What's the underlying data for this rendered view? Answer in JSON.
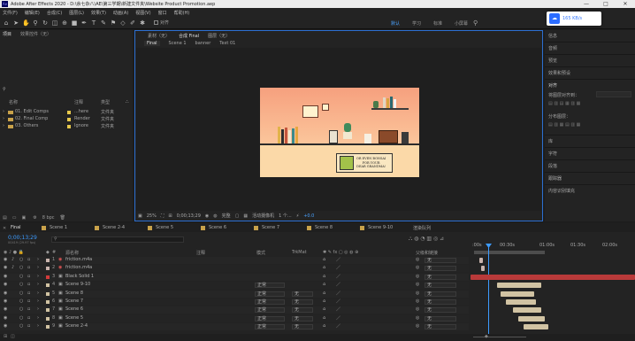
{
  "window": {
    "title": "Adobe After Effects 2020 - D:\\余七杂八\\AE\\第三学期\\新建文件夹\\Website Product Promotion.aep",
    "minimize": "—",
    "maximize": "□",
    "close": "✕"
  },
  "menu": [
    "文件(F)",
    "编辑(E)",
    "合成(C)",
    "图层(L)",
    "效果(T)",
    "动画(A)",
    "视图(V)",
    "窗口",
    "帮助(H)"
  ],
  "toolbar": {
    "snap_label": "对齐",
    "workspaces": [
      "默认",
      "学习",
      "标准",
      "小屏幕"
    ],
    "active_workspace": "默认"
  },
  "network_widget": {
    "speed": "165 KB/s"
  },
  "project_panel": {
    "tabs": [
      "项目",
      "效果控件（无）"
    ],
    "columns": [
      "名称",
      "注释",
      "类型"
    ],
    "items": [
      {
        "name": "01. Edit Comps",
        "comment": "...here",
        "type": "文件夹"
      },
      {
        "name": "02. Final Comp",
        "comment": "Render",
        "type": "文件夹"
      },
      {
        "name": "03. Others",
        "comment": "Ignore",
        "type": "文件夹"
      }
    ],
    "footer_bpc": "8 bpc"
  },
  "composition_panel": {
    "tabs": [
      "素材（无）",
      "合成 Final",
      "图层（无）"
    ],
    "breadcrumbs": [
      "Final",
      "Scene 1",
      "banner",
      "Text 01"
    ],
    "footer": {
      "zoom": "25%",
      "timecode": "0;00;13;29",
      "resolution": "完整",
      "camera": "活动摄像机",
      "views": "1 个...",
      "exposure": "+0.0"
    },
    "canvas_text": [
      "OR EVEN BONSAI",
      "FOR YOUR",
      "DEAR GRANDMA!"
    ]
  },
  "right_panels": [
    "信息",
    "音频",
    "预览",
    "效果和预设",
    "对齐",
    "将图层对齐到：",
    "分布图层：",
    "库",
    "字符",
    "段落",
    "跟踪器",
    "内容识别填充"
  ],
  "timeline": {
    "tabs": [
      "Final",
      "Scene 1",
      "Scene 2-4",
      "Scene 5",
      "Scene 6",
      "Scene 7",
      "Scene 8",
      "Scene 9-10",
      "渲染队列"
    ],
    "timecode": "0;00;13;29",
    "fps": "00419 (29.97 fps)",
    "columns": {
      "source": "源名称",
      "comment": "注释",
      "mode": "模式",
      "trkmat": "TrkMat",
      "parent": "父级和链接"
    },
    "ruler_labels": [
      ":00s",
      "00:30s",
      "01:00s",
      "01:30s",
      "02:00s"
    ],
    "layers": [
      {
        "num": "1",
        "name": "friction.m4a",
        "mode": "",
        "trkmat": "",
        "parent": "无",
        "color": "#c9b4ad"
      },
      {
        "num": "2",
        "name": "friction.m4a",
        "mode": "",
        "trkmat": "",
        "parent": "无",
        "color": "#c9b4ad"
      },
      {
        "num": "3",
        "name": "Black Solid 1",
        "mode": "",
        "trkmat": "",
        "parent": "无",
        "color": "#d33b3b"
      },
      {
        "num": "4",
        "name": "Scene 9-10",
        "mode": "正常",
        "trkmat": "",
        "parent": "无",
        "color": "#d1c3a3"
      },
      {
        "num": "5",
        "name": "Scene 8",
        "mode": "正常",
        "trkmat": "无",
        "parent": "无",
        "color": "#d1c3a3"
      },
      {
        "num": "6",
        "name": "Scene 7",
        "mode": "正常",
        "trkmat": "无",
        "parent": "无",
        "color": "#d1c3a3"
      },
      {
        "num": "7",
        "name": "Scene 6",
        "mode": "正常",
        "trkmat": "无",
        "parent": "无",
        "color": "#d1c3a3"
      },
      {
        "num": "8",
        "name": "Scene 5",
        "mode": "正常",
        "trkmat": "无",
        "parent": "无",
        "color": "#d1c3a3"
      },
      {
        "num": "9",
        "name": "Scene 2-4",
        "mode": "正常",
        "trkmat": "无",
        "parent": "无",
        "color": "#d1c3a3"
      }
    ]
  }
}
